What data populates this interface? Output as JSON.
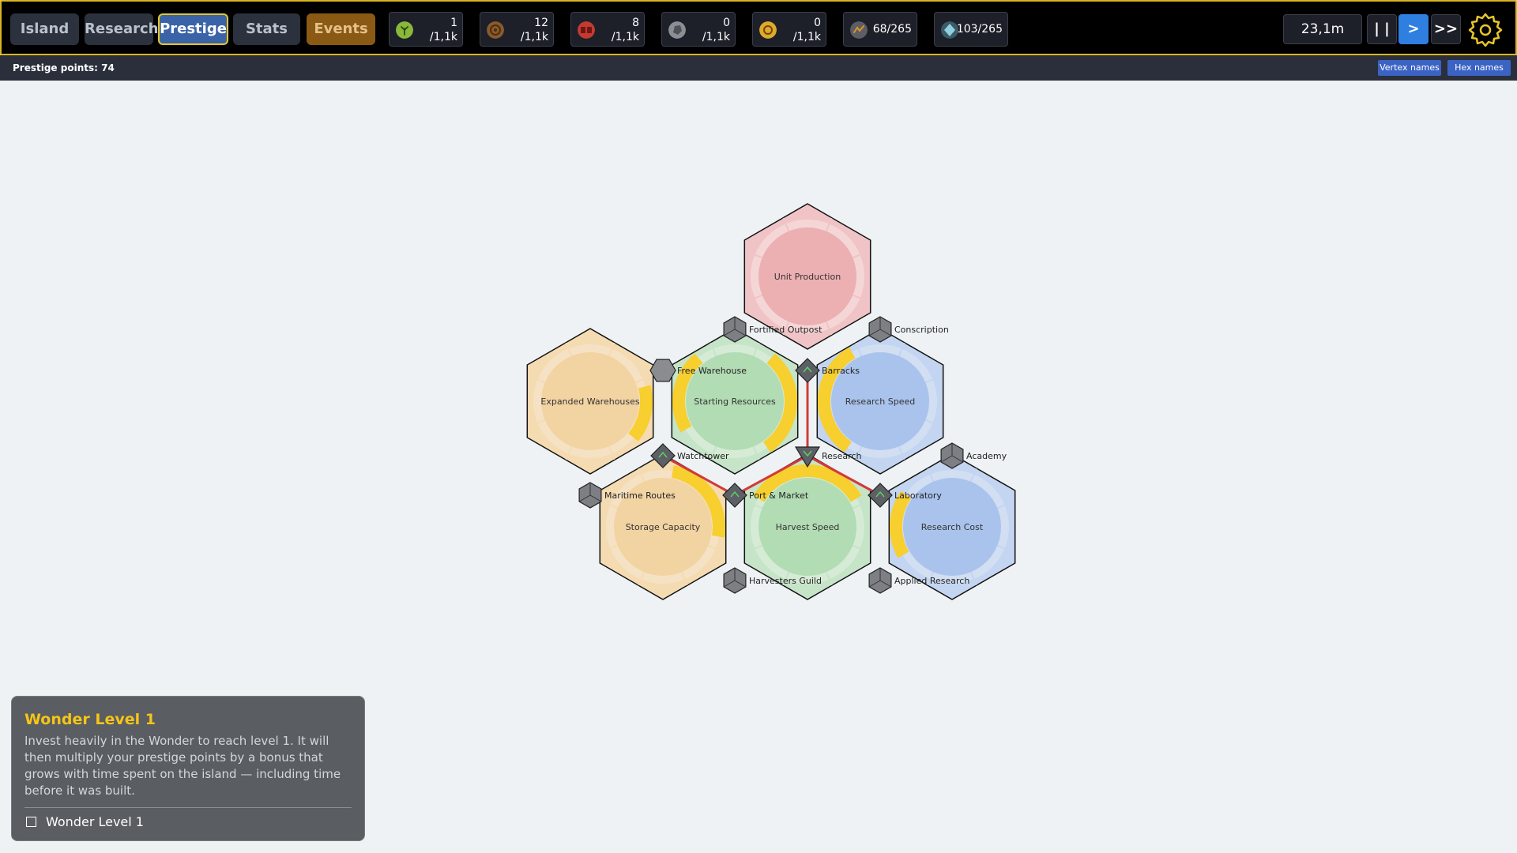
{
  "nav": {
    "tabs": [
      {
        "label": "Island"
      },
      {
        "label": "Research"
      },
      {
        "label": "Prestige",
        "active": true
      },
      {
        "label": "Stats"
      },
      {
        "label": "Events"
      }
    ]
  },
  "resources": [
    {
      "icon": "sapling-icon",
      "color": "#8ab83a",
      "value": "1",
      "max": "/1,1k"
    },
    {
      "icon": "wood-ring-icon",
      "color": "#8a5a2b",
      "value": "12",
      "max": "/1,1k"
    },
    {
      "icon": "brick-icon",
      "color": "#c53a30",
      "value": "8",
      "max": "/1,1k"
    },
    {
      "icon": "stone-icon",
      "color": "#8b8e93",
      "value": "0",
      "max": "/1,1k"
    },
    {
      "icon": "gold-coin-icon",
      "color": "#e0a92a",
      "value": "0",
      "max": "/1,1k"
    },
    {
      "icon": "population-icon",
      "color": "#7a7d82",
      "value": "68/265"
    },
    {
      "icon": "crystal-icon",
      "color": "#7fb6c9",
      "value": "103/265"
    }
  ],
  "controls": {
    "time": "23,1m",
    "pause": "| |",
    "play": ">",
    "fast": ">>"
  },
  "subbar": {
    "prestige_points": "Prestige points: 74",
    "vertex_names": "Vertex names",
    "hex_names": "Hex names"
  },
  "tree": {
    "hexes": [
      {
        "label": "Unit Production",
        "color": "pink"
      },
      {
        "label": "Expanded Warehouses",
        "color": "orange"
      },
      {
        "label": "Starting Resources",
        "color": "green"
      },
      {
        "label": "Research Speed",
        "color": "blue"
      },
      {
        "label": "Storage Capacity",
        "color": "orange"
      },
      {
        "label": "Harvest Speed",
        "color": "green"
      },
      {
        "label": "Research Cost",
        "color": "blue"
      }
    ],
    "vertices": [
      {
        "label": "Fortified Outpost"
      },
      {
        "label": "Conscription"
      },
      {
        "label": "Free Warehouse"
      },
      {
        "label": "Barracks"
      },
      {
        "label": "Watchtower"
      },
      {
        "label": "Research"
      },
      {
        "label": "Academy"
      },
      {
        "label": "Maritime Routes"
      },
      {
        "label": "Port & Market"
      },
      {
        "label": "Laboratory"
      },
      {
        "label": "Harvesters Guild"
      },
      {
        "label": "Applied Research"
      }
    ]
  },
  "tooltip": {
    "title": "Wonder Level 1",
    "description": "Invest heavily in the Wonder to reach level 1. It will then multiply your prestige points by a bonus that grows with time spent on the island — including time before it was built.",
    "requirement": "Wonder Level 1"
  }
}
